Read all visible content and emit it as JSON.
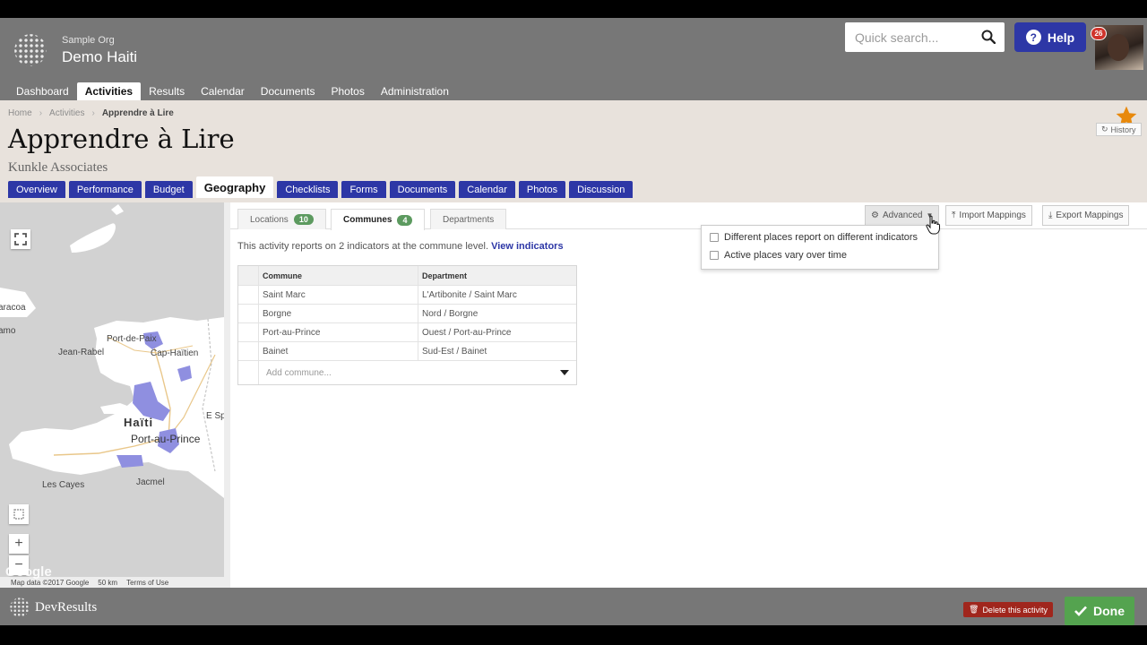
{
  "header": {
    "org_small": "Sample Org",
    "org_name": "Demo Haiti",
    "search_placeholder": "Quick search...",
    "help_label": "Help",
    "notification_count": "26",
    "nav": [
      "Dashboard",
      "Activities",
      "Results",
      "Calendar",
      "Documents",
      "Photos",
      "Administration"
    ],
    "nav_active": "Activities"
  },
  "breadcrumb": [
    "Home",
    "Activities",
    "Apprendre à Lire"
  ],
  "page": {
    "title": "Apprendre à Lire",
    "subtitle": "Kunkle Associates",
    "star_color": "#e8890c"
  },
  "tabs": [
    "Overview",
    "Performance",
    "Budget",
    "Geography",
    "Checklists",
    "Forms",
    "Documents",
    "Calendar",
    "Photos",
    "Discussion"
  ],
  "active_tab": "Geography",
  "history_label": "History",
  "map": {
    "labels": [
      "aracoa",
      "amo",
      "Port-de-Paix",
      "Jean-Rabel",
      "Cap-Haïtien",
      "Haïti",
      "Port-au-Prince",
      "Les Cayes",
      "Jacmel",
      "E Sp"
    ],
    "attribution": "Map data ©2017 Google",
    "scale": "50 km",
    "terms": "Terms of Use",
    "google": "Google",
    "zoom_in": "+",
    "zoom_out": "−",
    "highlight_color": "#8f8fe0"
  },
  "subtabs": [
    {
      "label": "Locations",
      "count": "10"
    },
    {
      "label": "Communes",
      "count": "4"
    },
    {
      "label": "Departments",
      "count": ""
    }
  ],
  "toolbar": {
    "advanced": "Advanced",
    "import": "Import Mappings",
    "export": "Export Mappings"
  },
  "advanced_menu": [
    "Different places report on different indicators",
    "Active places vary over time"
  ],
  "info": {
    "text": "This activity reports on 2 indicators at the commune level.",
    "link": "View indicators"
  },
  "table": {
    "headers": [
      "Commune",
      "Department"
    ],
    "rows": [
      [
        "Saint Marc",
        "L'Artibonite / Saint Marc"
      ],
      [
        "Borgne",
        "Nord / Borgne"
      ],
      [
        "Port-au-Prince",
        "Ouest / Port-au-Prince"
      ],
      [
        "Bainet",
        "Sud-Est / Bainet"
      ]
    ],
    "add_placeholder": "Add commune..."
  },
  "footer": {
    "brand": "DevResults",
    "delete_label": "Delete this activity",
    "done_label": "Done"
  },
  "colors": {
    "brand_blue": "#2d37a6",
    "header_gray": "#777777",
    "badge_green": "#5c9a5f",
    "done_green": "#54a34f",
    "delete_red": "#a0261d"
  }
}
